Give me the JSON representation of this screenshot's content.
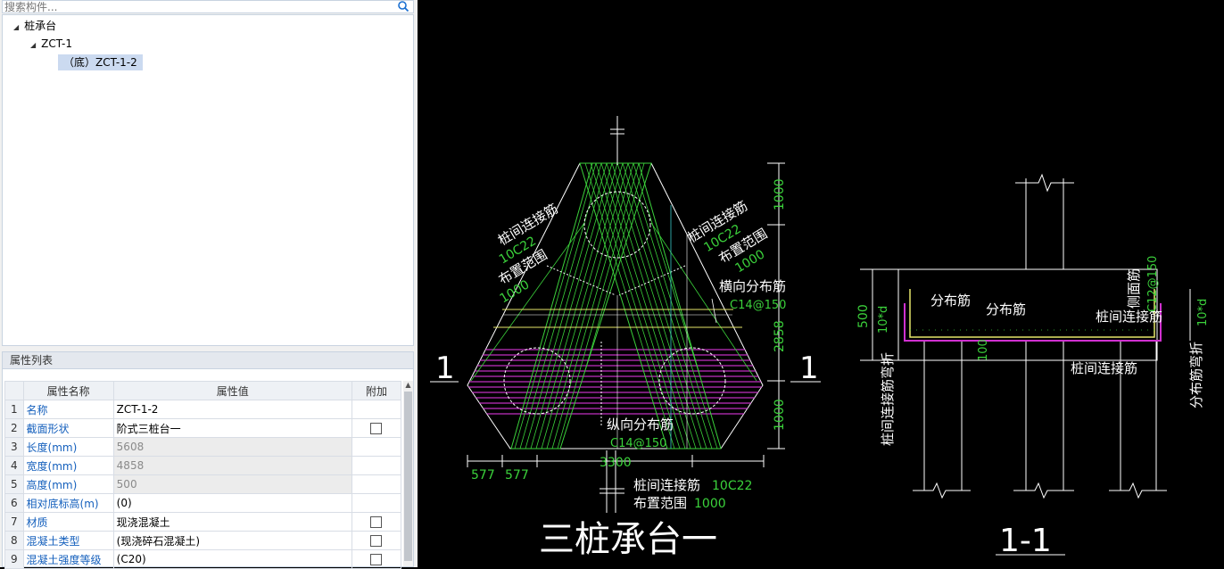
{
  "search": {
    "placeholder": "搜索构件..."
  },
  "tree": {
    "root": "桩承台",
    "child": "ZCT-1",
    "leaf": "（底）ZCT-1-2"
  },
  "props": {
    "title": "属性列表",
    "col_name": "属性名称",
    "col_value": "属性值",
    "col_extra": "附加",
    "rows": [
      {
        "idx": "1",
        "name": "名称",
        "value": "ZCT-1-2"
      },
      {
        "idx": "2",
        "name": "截面形状",
        "value": "阶式三桩台一"
      },
      {
        "idx": "3",
        "name": "长度(mm)",
        "value": "5608"
      },
      {
        "idx": "4",
        "name": "宽度(mm)",
        "value": "4858"
      },
      {
        "idx": "5",
        "name": "高度(mm)",
        "value": "500"
      },
      {
        "idx": "6",
        "name": "相对底标高(m)",
        "value": "(0)"
      },
      {
        "idx": "7",
        "name": "材质",
        "value": "现浇混凝土"
      },
      {
        "idx": "8",
        "name": "混凝土类型",
        "value": "(现浇碎石混凝土)"
      },
      {
        "idx": "9",
        "name": "混凝土强度等级",
        "value": "(C20)"
      }
    ]
  },
  "drawing": {
    "plan_title": "三桩承台一",
    "section_title": "1-1",
    "section_mark": "1",
    "lbl_link_left": "桩间连接筋",
    "lbl_link_left_spec": "10C22",
    "lbl_range_left": "布置范围",
    "lbl_range_left_val": "1000",
    "lbl_link_right": "桩间连接筋",
    "lbl_link_right_spec": "10C22",
    "lbl_range_right": "布置范围",
    "lbl_range_right_val": "1000",
    "lbl_transverse": "横向分布筋",
    "lbl_transverse_spec": "C14@150",
    "lbl_longitudinal": "纵向分布筋",
    "lbl_longitudinal_spec": "C14@150",
    "lbl_bottom_link": "桩间连接筋",
    "lbl_bottom_link_spec": "10C22",
    "lbl_bottom_range": "布置范围",
    "lbl_bottom_range_val": "1000",
    "dim_1000_top": "1000",
    "dim_2858": "2858",
    "dim_1000_bottom": "1000",
    "dim_577_a": "577",
    "dim_577_b": "577",
    "dim_3300": "3300",
    "sec_dist1": "分布筋",
    "sec_dist2": "分布筋",
    "sec_side": "侧面筋",
    "sec_side_spec": "C12@150",
    "sec_link": "桩间连接筋",
    "sec_link2": "桩间连接筋",
    "sec_500": "500",
    "sec_10d_left": "10*d",
    "sec_10d_right": "10*d",
    "sec_100": "100",
    "sec_link_bend": "桩间连接筋弯折",
    "sec_dist_bend": "分布筋弯折"
  }
}
